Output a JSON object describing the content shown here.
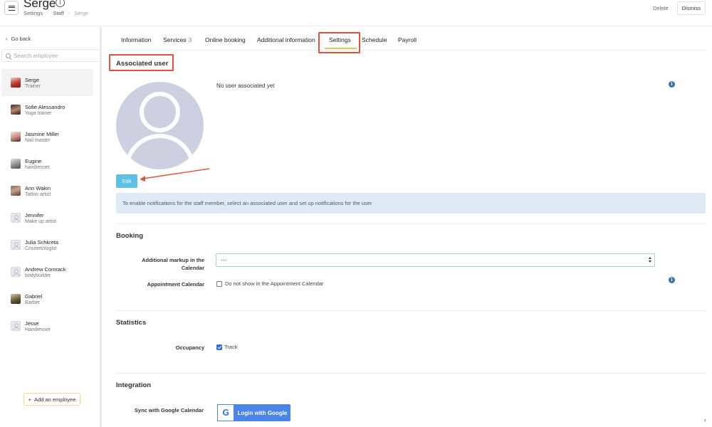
{
  "header": {
    "title": "Serge",
    "breadcrumb": [
      "Settings",
      "Staff",
      "Serge"
    ],
    "delete_label": "Delete",
    "dismiss_label": "Dismiss"
  },
  "sidebar": {
    "go_back": "Go back",
    "search_placeholder": "Search employee",
    "employees": [
      {
        "name": "Serge",
        "role": "Trainer",
        "avatar": "photo",
        "active": true
      },
      {
        "name": "Sofie Alessandro",
        "role": "Yoga trainer",
        "avatar": "photo"
      },
      {
        "name": "Jasmine Miller",
        "role": "Nail master",
        "avatar": "photo"
      },
      {
        "name": "Eugine",
        "role": "hairdresser",
        "avatar": "photo"
      },
      {
        "name": "Ann Wakin",
        "role": "Tattoo artist",
        "avatar": "photo"
      },
      {
        "name": "Jennifer",
        "role": "Make up artist",
        "avatar": "placeholder"
      },
      {
        "name": "Julia Schkreta",
        "role": "Cosmetologist",
        "avatar": "placeholder"
      },
      {
        "name": "Andrew Comrack",
        "role": "bodybuilder",
        "avatar": "placeholder"
      },
      {
        "name": "Gabriel",
        "role": "Barber",
        "avatar": "photo"
      },
      {
        "name": "Jesse",
        "role": "Hairdresser",
        "avatar": "placeholder"
      }
    ],
    "add_employee": "Add an employee"
  },
  "tabs": [
    {
      "label": "Information"
    },
    {
      "label": "Services",
      "count": "3"
    },
    {
      "label": "Online booking"
    },
    {
      "label": "Additional information"
    },
    {
      "label": "Settings",
      "active": true
    },
    {
      "label": "Schedule"
    },
    {
      "label": "Payroll"
    }
  ],
  "associated_user": {
    "title": "Associated user",
    "no_user_text": "No user associated yet",
    "edit_label": "Edit",
    "notice": "To enable notifications for the staff member, select an associated user and set up notifications for the user"
  },
  "booking": {
    "title": "Booking",
    "markup_label": "Additional markup in the Calendar",
    "markup_value": "---",
    "calendar_label": "Appointment Calendar",
    "calendar_option": "Do not show in the Appointment Calendar",
    "calendar_option_checked": false
  },
  "statistics": {
    "title": "Statistics",
    "occupancy_label": "Occupancy",
    "occupancy_option": "Track",
    "occupancy_checked": true
  },
  "integration": {
    "title": "Integration",
    "sync_label": "Sync with Google Calendar",
    "login_button": "Login with Google",
    "google_letter": "G"
  },
  "colors": {
    "highlight": "#e2533b",
    "edit_button": "#5dc0e6",
    "google_button": "#4b84e8",
    "notice_bg": "#dfeaf6",
    "tab_underline": "#f0c24f"
  }
}
